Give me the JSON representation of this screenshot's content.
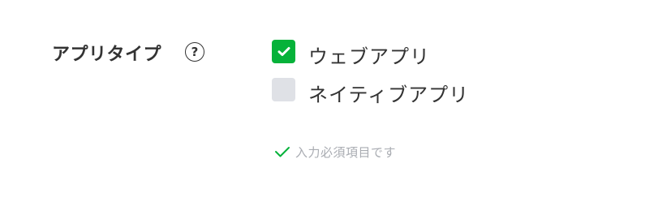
{
  "field": {
    "label": "アプリタイプ",
    "help_icon": "question-circle-icon",
    "help_glyph": "?"
  },
  "options": [
    {
      "label": "ウェブアプリ",
      "checked": true,
      "icon": "checkmark-icon"
    },
    {
      "label": "ネイティブアプリ",
      "checked": false
    }
  ],
  "validation": {
    "icon": "checkmark-icon",
    "text": "入力必須項目です"
  },
  "colors": {
    "accent": "#06b23a",
    "checkbox_unchecked": "#dfe1e6",
    "label_text": "#333333",
    "hint_text": "#a9acb2"
  }
}
